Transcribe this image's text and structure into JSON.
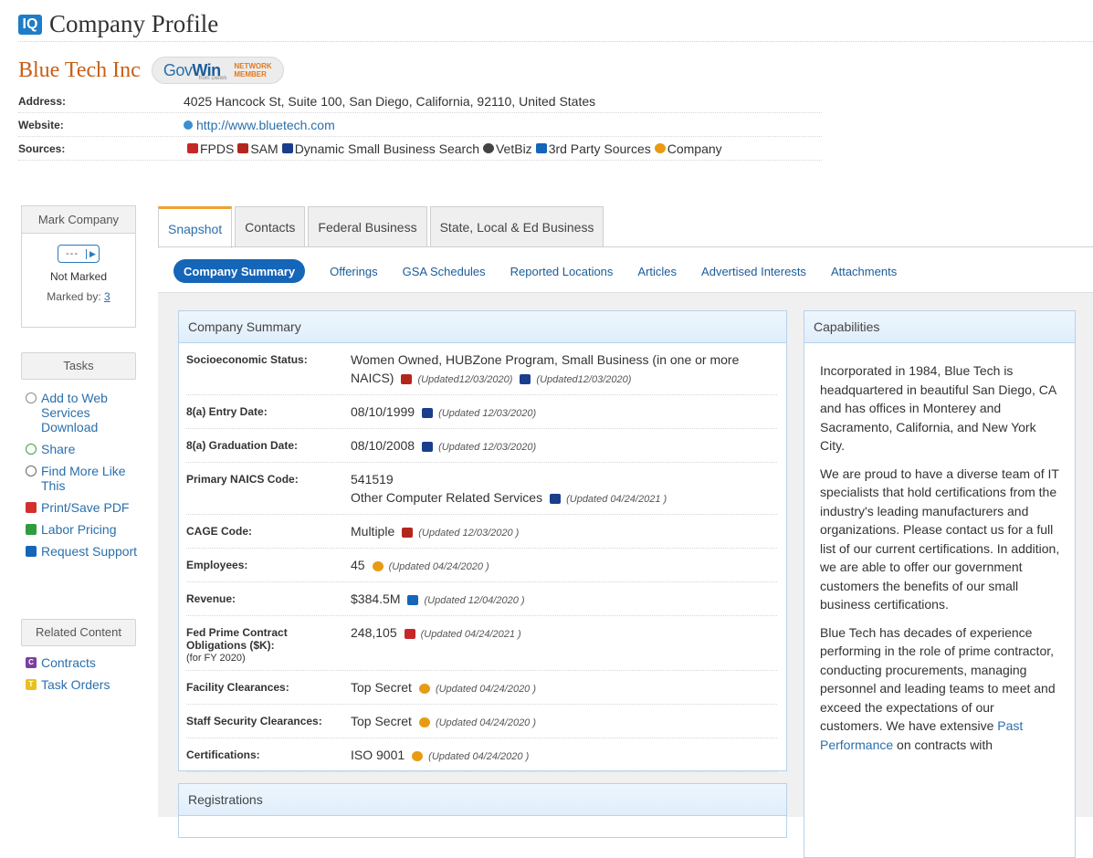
{
  "header": {
    "logo": "IQ",
    "title": "Company Profile"
  },
  "company": {
    "name": "Blue Tech Inc",
    "badge": {
      "brand_a": "Gov",
      "brand_b": "Win",
      "sub": "from Deltek",
      "network": "NETWORK",
      "member": "MEMBER"
    }
  },
  "info": {
    "address_label": "Address:",
    "address": "4025 Hancock St, Suite 100, San Diego, California, 92110, United States",
    "website_label": "Website:",
    "website": "http://www.bluetech.com",
    "sources_label": "Sources:",
    "sources": [
      {
        "label": "FPDS",
        "icon": "fpds-icon",
        "color": "#c62828"
      },
      {
        "label": "SAM",
        "icon": "sam-icon",
        "color": "#b3261e"
      },
      {
        "label": "Dynamic Small Business Search",
        "icon": "dsbs-icon",
        "color": "#1a3e8c"
      },
      {
        "label": "VetBiz",
        "icon": "vetbiz-icon",
        "color": "#444444"
      },
      {
        "label": "3rd Party Sources",
        "icon": "third-party-icon",
        "color": "#1565b8"
      },
      {
        "label": "Company",
        "icon": "company-icon",
        "color": "#e89b12"
      }
    ]
  },
  "mark": {
    "title": "Mark Company",
    "toggle": "---",
    "status": "Not Marked",
    "marked_by_label": "Marked by:",
    "marked_by_count": "3"
  },
  "tasks": {
    "title": "Tasks",
    "items": [
      {
        "label": "Add to Web Services Download",
        "icon": "gear-icon",
        "color": "#8a8a8a"
      },
      {
        "label": "Share",
        "icon": "share-icon",
        "color": "#3ba33b"
      },
      {
        "label": "Find More Like This",
        "icon": "search-icon",
        "color": "#666666"
      },
      {
        "label": "Print/Save PDF",
        "icon": "pdf-icon",
        "color": "#d32f2f"
      },
      {
        "label": "Labor Pricing",
        "icon": "dollar-icon",
        "color": "#2e9d3e"
      },
      {
        "label": "Request Support",
        "icon": "support-icon",
        "color": "#1565b8"
      }
    ]
  },
  "related": {
    "title": "Related Content",
    "items": [
      {
        "label": "Contracts",
        "icon": "contracts-icon",
        "color": "#7b3fa0",
        "glyph": "C"
      },
      {
        "label": "Task Orders",
        "icon": "task-orders-icon",
        "color": "#e8c020",
        "glyph": "T"
      }
    ]
  },
  "tabs": [
    "Snapshot",
    "Contacts",
    "Federal Business",
    "State, Local & Ed Business"
  ],
  "subtabs": [
    "Company Summary",
    "Offerings",
    "GSA Schedules",
    "Reported Locations",
    "Articles",
    "Advertised Interests",
    "Attachments"
  ],
  "summary": {
    "title": "Company Summary",
    "rows": [
      {
        "label": "Socioeconomic Status:",
        "value": "Women Owned, HUBZone Program, Small Business (in one or more NAICS)",
        "u1": "(Updated12/03/2020)",
        "u2": "(Updated12/03/2020)"
      },
      {
        "label": "8(a) Entry Date:",
        "value": "08/10/1999",
        "u": "(Updated 12/03/2020)"
      },
      {
        "label": "8(a) Graduation Date:",
        "value": "08/10/2008",
        "u": "(Updated 12/03/2020)"
      },
      {
        "label": "Primary NAICS Code:",
        "value": "541519",
        "value2": "Other Computer Related Services",
        "u": "(Updated 04/24/2021 )"
      },
      {
        "label": "CAGE Code:",
        "value": "Multiple",
        "u": "(Updated 12/03/2020 )"
      },
      {
        "label": "Employees:",
        "value": "45",
        "u": "(Updated 04/24/2020 )"
      },
      {
        "label": "Revenue:",
        "value": "$384.5M",
        "u": "(Updated 12/04/2020 )"
      },
      {
        "label": "Fed Prime Contract Obligations ($K):",
        "sub": "(for FY 2020)",
        "value": "248,105",
        "u": "(Updated 04/24/2021 )"
      },
      {
        "label": "Facility Clearances:",
        "value": "Top Secret",
        "u": "(Updated 04/24/2020 )"
      },
      {
        "label": "Staff Security Clearances:",
        "value": "Top Secret",
        "u": "(Updated 04/24/2020 )"
      },
      {
        "label": "Certifications:",
        "value": "ISO 9001",
        "u": "(Updated 04/24/2020 )"
      }
    ]
  },
  "registrations": {
    "title": "Registrations"
  },
  "capabilities": {
    "title": "Capabilities",
    "p1": "Incorporated in 1984, Blue Tech is headquartered in beautiful San Diego, CA and has offices in Monterey and Sacramento, California, and New York City.",
    "p2": "We are proud to have a diverse team of IT specialists that hold certifications from the industry's leading manufacturers and organizations. Please contact us for a full list of our current certifications. In addition, we are able to offer our government customers the benefits of our small business certifications.",
    "p3a": "Blue Tech has decades of experience performing in the role of prime contractor, conducting procurements, managing personnel and leading teams to meet and exceed the expectations of our customers. We have extensive ",
    "p3link": "Past Performance",
    "p3b": " on contracts with"
  }
}
